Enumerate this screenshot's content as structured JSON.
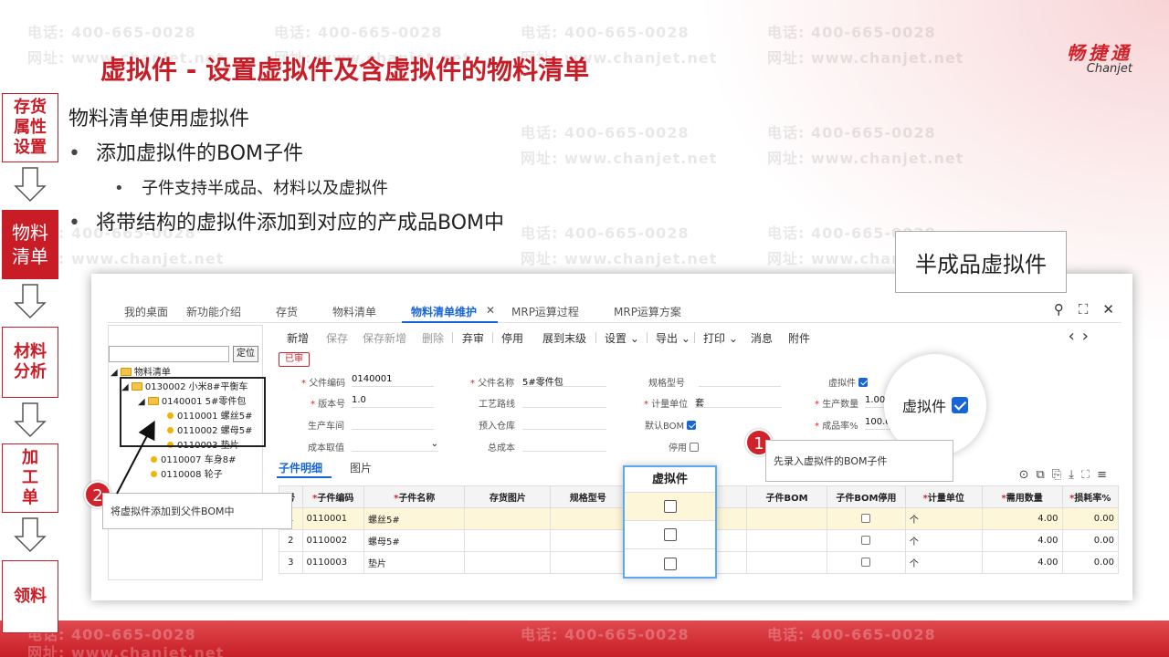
{
  "slide": {
    "title": "虚拟件 - 设置虚拟件及含虚拟件的物料清单",
    "logo_cn": "畅捷通",
    "logo_en": "Chanjet",
    "watermark_phone": "电话: 400-665-0028",
    "watermark_site": "网址: www.chanjet.net"
  },
  "flow": [
    {
      "label": "存货\n属性\n设置"
    },
    {
      "label": "物料\n清单"
    },
    {
      "label": "材料\n分析"
    },
    {
      "label": "加\n工\n单"
    },
    {
      "label": "领料"
    }
  ],
  "bullets": {
    "heading": "物料清单使用虚拟件",
    "item1": "添加虚拟件的BOM子件",
    "item1_sub": "子件支持半成品、材料以及虚拟件",
    "item2": "将带结构的虚拟件添加到对应的产成品BOM中"
  },
  "app": {
    "tabs": [
      "我的桌面",
      "新功能介绍",
      "存货",
      "物料清单",
      "物料清单维护",
      "MRP运算过程",
      "MRP运算方案"
    ],
    "tree": {
      "locate_btn": "定位",
      "root": "物料清单",
      "n1": "0130002 小米8#平衡车",
      "n2": "0140001 5#零件包",
      "n3": "0110001 螺丝5#",
      "n4": "0110002 螺母5#",
      "n5": "0110003 垫片",
      "n6": "0110007 车身8#",
      "n7": "0110008 轮子"
    },
    "toolbar": [
      "新增",
      "保存",
      "保存新增",
      "删除",
      "弃审",
      "停用",
      "展到末级",
      "设置",
      "导出",
      "打印",
      "消息",
      "附件"
    ],
    "status_badge": "已审",
    "form": {
      "parent_code_label": "父件编码",
      "parent_code": "0140001",
      "parent_name_label": "父件名称",
      "parent_name": "5#零件包",
      "spec_label": "规格型号",
      "phantom_label": "虚拟件",
      "version_label": "版本号",
      "version": "1.0",
      "route_label": "工艺路线",
      "unit_label": "计量单位",
      "unit": "套",
      "qty_label": "生产数量",
      "qty": "1.00",
      "workshop_label": "生产车间",
      "warehouse_label": "预入仓库",
      "default_bom_label": "默认BOM",
      "yield_label": "成品率%",
      "yield": "100.0",
      "cost_label": "成本取值",
      "total_cost_label": "总成本",
      "disabled_label": "停用"
    },
    "subtabs": [
      "子件明细",
      "图片"
    ],
    "table": {
      "headers": [
        "号",
        "子件编码",
        "子件名称",
        "存货图片",
        "规格型号",
        "虚拟件",
        "停用",
        "子件BOM",
        "子件BOM停用",
        "计量单位",
        "需用数量",
        "损耗率%"
      ],
      "rows": [
        {
          "no": "1",
          "code": "0110001",
          "name": "螺丝5#",
          "unit": "个",
          "qty": "4.00",
          "loss": "0.00"
        },
        {
          "no": "2",
          "code": "0110002",
          "name": "螺母5#",
          "unit": "个",
          "qty": "4.00",
          "loss": "0.00"
        },
        {
          "no": "3",
          "code": "0110003",
          "name": "垫片",
          "unit": "个",
          "qty": "4.00",
          "loss": "0.00"
        }
      ]
    }
  },
  "callouts": {
    "semi_phantom": "半成品虚拟件",
    "zoom_label": "虚拟件",
    "col_zoom_header": "虚拟件",
    "step1": "1",
    "step1_note": "先录入虚拟件的BOM子件",
    "step2": "2",
    "step2_note": "将虚拟件添加到父件BOM中"
  }
}
